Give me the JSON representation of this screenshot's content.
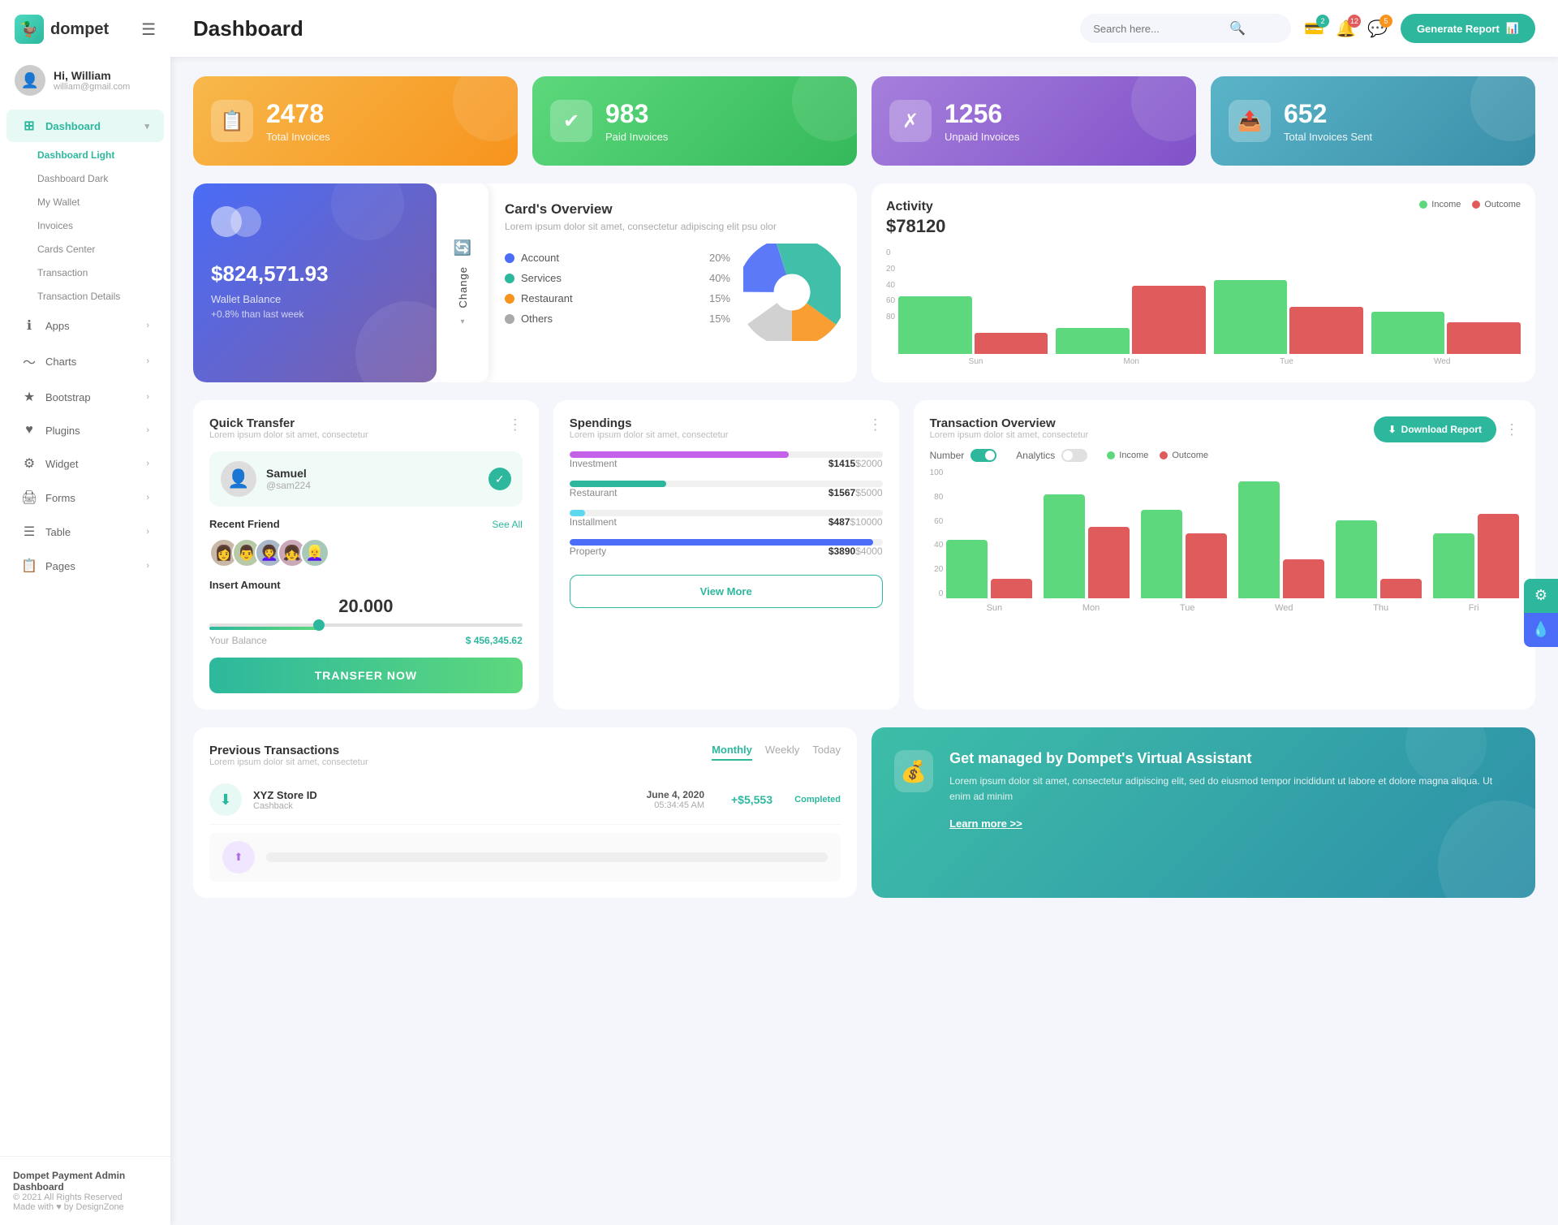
{
  "app": {
    "name": "dompet",
    "title": "Dashboard"
  },
  "header": {
    "title": "Dashboard",
    "search_placeholder": "Search here...",
    "generate_btn": "Generate Report",
    "badges": {
      "wallet": "2",
      "bell": "12",
      "chat": "5"
    }
  },
  "user": {
    "greeting": "Hi, William",
    "email": "william@gmail.com"
  },
  "sidebar": {
    "nav_items": [
      {
        "label": "Dashboard",
        "icon": "⊞",
        "active": true,
        "arrow": "▾"
      },
      {
        "label": "Apps",
        "icon": "ℹ",
        "arrow": "›"
      },
      {
        "label": "Charts",
        "icon": "📈",
        "arrow": "›"
      },
      {
        "label": "Bootstrap",
        "icon": "★",
        "arrow": "›"
      },
      {
        "label": "Plugins",
        "icon": "♥",
        "arrow": "›"
      },
      {
        "label": "Widget",
        "icon": "⚙",
        "arrow": "›"
      },
      {
        "label": "Forms",
        "icon": "🖨",
        "arrow": "›"
      },
      {
        "label": "Table",
        "icon": "☰",
        "arrow": "›"
      },
      {
        "label": "Pages",
        "icon": "📋",
        "arrow": "›"
      }
    ],
    "sub_items": [
      {
        "label": "Dashboard Light",
        "active": true
      },
      {
        "label": "Dashboard Dark"
      },
      {
        "label": "My Wallet"
      },
      {
        "label": "Invoices"
      },
      {
        "label": "Cards Center"
      },
      {
        "label": "Transaction"
      },
      {
        "label": "Transaction Details"
      }
    ],
    "footer": {
      "brand": "Dompet Payment Admin Dashboard",
      "copyright": "© 2021 All Rights Reserved",
      "made_with": "Made with ♥ by DesignZone"
    }
  },
  "stats": [
    {
      "num": "2478",
      "label": "Total Invoices",
      "icon": "📋",
      "color": "orange"
    },
    {
      "num": "983",
      "label": "Paid Invoices",
      "icon": "✓",
      "color": "green"
    },
    {
      "num": "1256",
      "label": "Unpaid Invoices",
      "icon": "✗",
      "color": "purple"
    },
    {
      "num": "652",
      "label": "Total Invoices Sent",
      "icon": "📤",
      "color": "teal"
    }
  ],
  "wallet_card": {
    "amount": "$824,571.93",
    "label": "Wallet Balance",
    "change": "+0.8% than last week",
    "change_btn": "Change"
  },
  "card_overview": {
    "title": "Card's Overview",
    "description": "Lorem ipsum dolor sit amet, consectetur adipiscing elit psu olor",
    "items": [
      {
        "label": "Account",
        "pct": "20%",
        "color": "#4a6cf7"
      },
      {
        "label": "Services",
        "pct": "40%",
        "color": "#2db89e"
      },
      {
        "label": "Restaurant",
        "pct": "15%",
        "color": "#f7941d"
      },
      {
        "label": "Others",
        "pct": "15%",
        "color": "#aaa"
      }
    ]
  },
  "activity": {
    "title": "Activity",
    "amount": "$78120",
    "legend": [
      {
        "label": "Income",
        "color": "#5dd87c"
      },
      {
        "label": "Outcome",
        "color": "#e05c5c"
      }
    ],
    "y_axis": [
      "80",
      "60",
      "40",
      "20",
      "0"
    ],
    "x_axis": [
      "Sun",
      "Mon",
      "Tue",
      "Wed"
    ],
    "bars": [
      {
        "income": 55,
        "outcome": 20
      },
      {
        "income": 25,
        "outcome": 65
      },
      {
        "income": 70,
        "outcome": 45
      },
      {
        "income": 40,
        "outcome": 30
      }
    ]
  },
  "quick_transfer": {
    "title": "Quick Transfer",
    "description": "Lorem ipsum dolor sit amet, consectetur",
    "recipient": {
      "name": "Samuel",
      "handle": "@sam224"
    },
    "recent_friend_label": "Recent Friend",
    "see_all": "See All",
    "insert_amount_label": "Insert Amount",
    "amount": "20.000",
    "balance_label": "Your Balance",
    "balance": "$ 456,345.62",
    "transfer_btn": "TRANSFER NOW"
  },
  "spendings": {
    "title": "Spendings",
    "description": "Lorem ipsum dolor sit amet, consectetur",
    "items": [
      {
        "label": "Investment",
        "amount": "$1415",
        "max": "$2000",
        "pct": 70,
        "color": "#c362e8"
      },
      {
        "label": "Restaurant",
        "amount": "$1567",
        "max": "$5000",
        "pct": 31,
        "color": "#2db89e"
      },
      {
        "label": "Installment",
        "amount": "$487",
        "max": "$10000",
        "pct": 5,
        "color": "#5dd8f0"
      },
      {
        "label": "Property",
        "amount": "$3890",
        "max": "$4000",
        "pct": 97,
        "color": "#4a6cf7"
      }
    ],
    "view_more_btn": "View More"
  },
  "transaction_overview": {
    "title": "Transaction Overview",
    "description": "Lorem ipsum dolor sit amet, consectetur",
    "download_btn": "Download Report",
    "toggle1_label": "Number",
    "toggle2_label": "Analytics",
    "legend": [
      {
        "label": "Income",
        "color": "#5dd87c"
      },
      {
        "label": "Outcome",
        "color": "#e05c5c"
      }
    ],
    "y_axis": [
      "100",
      "80",
      "60",
      "40",
      "20",
      "0"
    ],
    "x_axis": [
      "Sun",
      "Mon",
      "Tue",
      "Wed",
      "Thu",
      "Fri"
    ],
    "bars": [
      {
        "income": 45,
        "outcome": 15
      },
      {
        "income": 80,
        "outcome": 55
      },
      {
        "income": 68,
        "outcome": 50
      },
      {
        "income": 90,
        "outcome": 30
      },
      {
        "income": 60,
        "outcome": 15
      },
      {
        "income": 50,
        "outcome": 65
      }
    ]
  },
  "previous_transactions": {
    "title": "Previous Transactions",
    "description": "Lorem ipsum dolor sit amet, consectetur",
    "tabs": [
      "Monthly",
      "Weekly",
      "Today"
    ],
    "active_tab": "Monthly",
    "items": [
      {
        "icon": "⬇",
        "name": "XYZ Store ID",
        "type": "Cashback",
        "date": "June 4, 2020",
        "time": "05:34:45 AM",
        "amount": "+$5,553",
        "status": "Completed",
        "icon_bg": "#e6f9f5"
      }
    ]
  },
  "virtual_assistant": {
    "icon": "💰",
    "title": "Get managed by Dompet's Virtual Assistant",
    "description": "Lorem ipsum dolor sit amet, consectetur adipiscing elit, sed do eiusmod tempor incididunt ut labore et dolore magna aliqua. Ut enim ad minim",
    "link": "Learn more >>"
  }
}
